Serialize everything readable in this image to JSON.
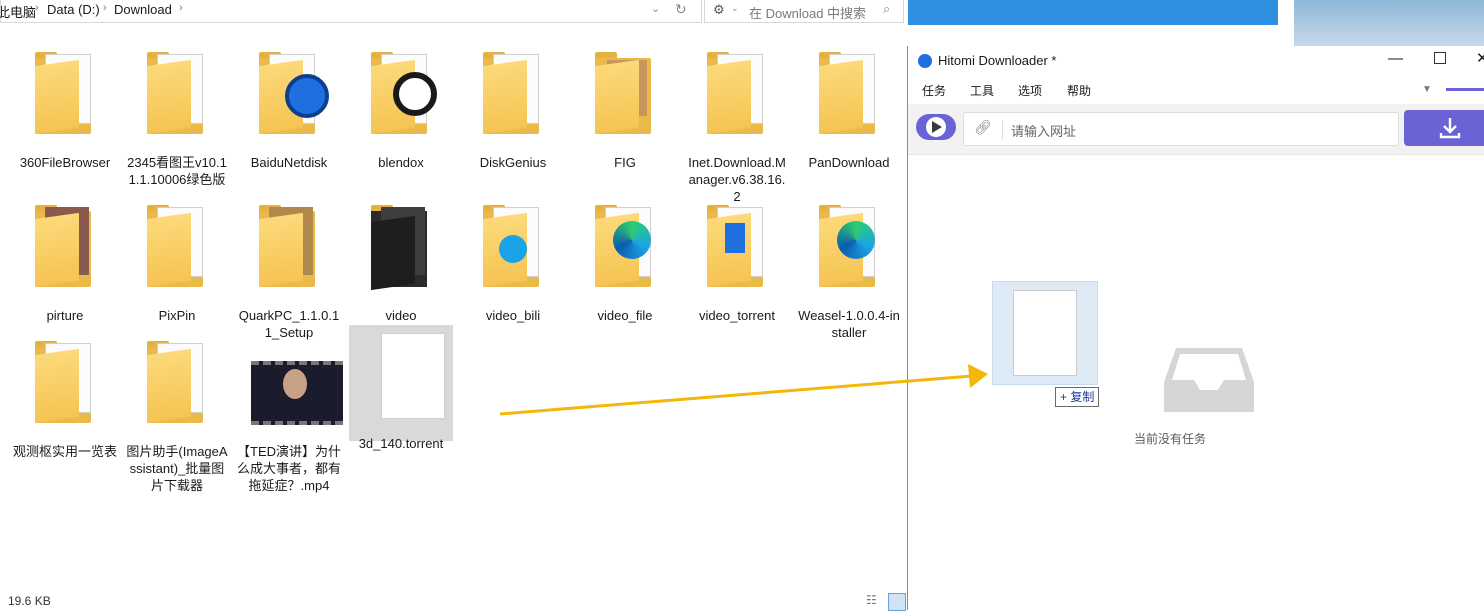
{
  "explorer": {
    "breadcrumb": [
      "此电脑",
      "Data (D:)",
      "Download"
    ],
    "search_placeholder": "在 Download 中搜索",
    "status_size": "19.6 KB",
    "files": [
      {
        "name": "360FileBrowser",
        "type": "folder"
      },
      {
        "name": "2345看图王v10.11.1.10006绿色版",
        "type": "folder"
      },
      {
        "name": "BaiduNetdisk",
        "type": "folder"
      },
      {
        "name": "blendox",
        "type": "folder"
      },
      {
        "name": "DiskGenius",
        "type": "folder"
      },
      {
        "name": "FIG",
        "type": "folder"
      },
      {
        "name": "Inet.Download.Manager.v6.38.16.2",
        "type": "folder"
      },
      {
        "name": "PanDownload",
        "type": "folder"
      },
      {
        "name": "pirture",
        "type": "folder"
      },
      {
        "name": "PixPin",
        "type": "folder"
      },
      {
        "name": "QuarkPC_1.1.0.11_Setup",
        "type": "folder"
      },
      {
        "name": "video",
        "type": "folder"
      },
      {
        "name": "video_bili",
        "type": "folder"
      },
      {
        "name": "video_file",
        "type": "folder"
      },
      {
        "name": "video_torrent",
        "type": "folder"
      },
      {
        "name": "Weasel-1.0.0.4-installer",
        "type": "folder"
      },
      {
        "name": "观测枢实用一览表",
        "type": "folder"
      },
      {
        "name": "图片助手(ImageAssistant)_批量图片下载器",
        "type": "folder"
      },
      {
        "name": "【TED演讲】为什么成大事者，都有拖延症？.mp4",
        "type": "video"
      },
      {
        "name": "3d_140.torrent",
        "type": "file",
        "selected": true
      }
    ]
  },
  "hitomi": {
    "title": "Hitomi Downloader *",
    "menu": [
      "任务",
      "工具",
      "选项",
      "帮助"
    ],
    "url_placeholder": "请输入网址",
    "empty_message": "当前没有任务",
    "drag_copy_label": "复制"
  },
  "colors": {
    "accent": "#6a63d6",
    "drag_arrow": "#f5b60a",
    "folder": "#f5c453"
  }
}
